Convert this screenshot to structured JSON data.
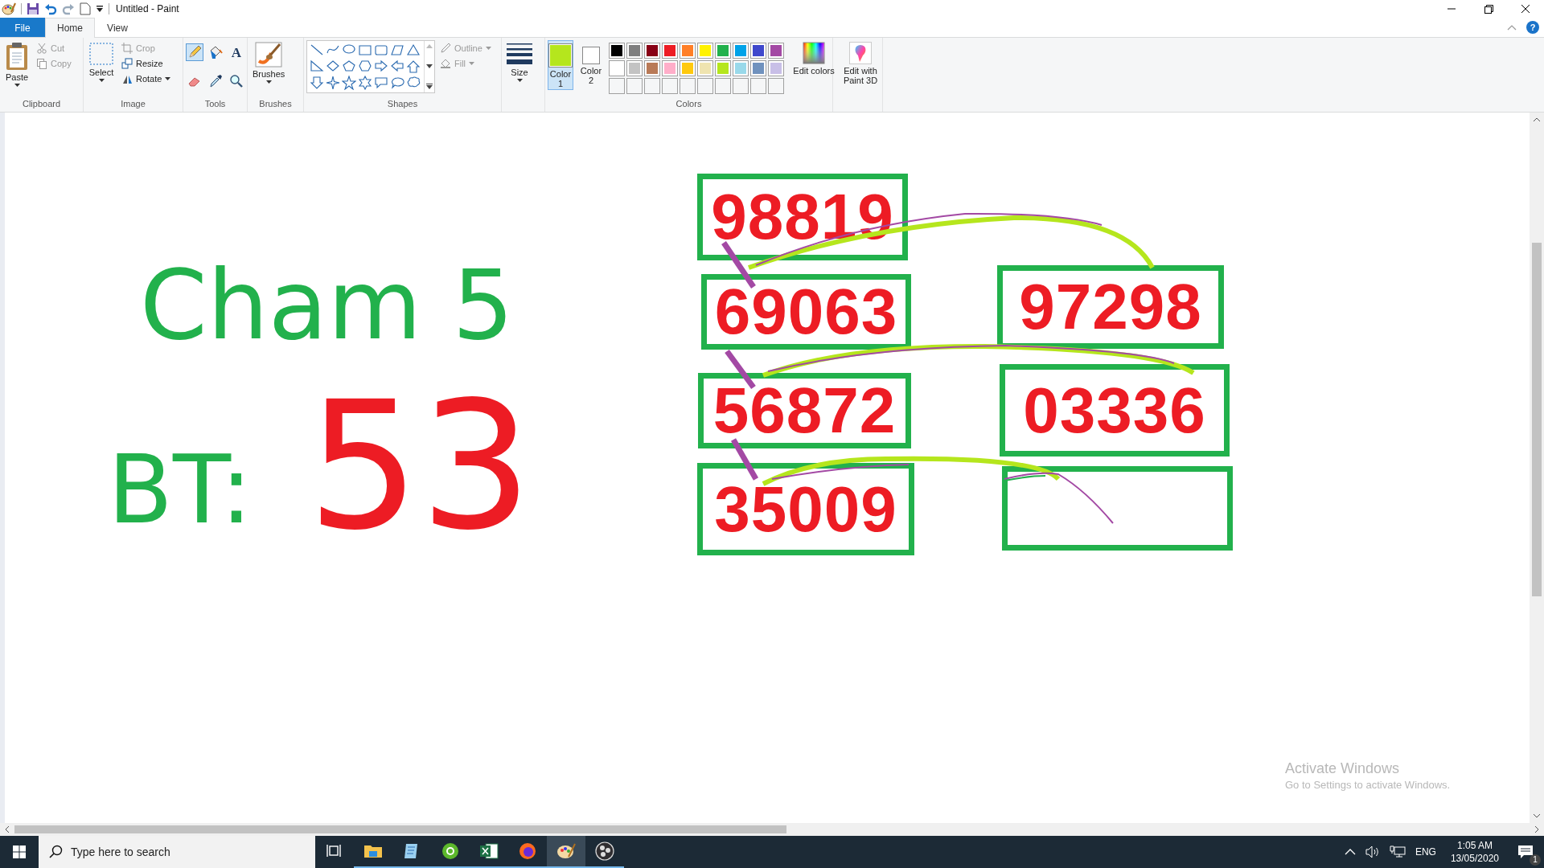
{
  "window": {
    "title": "Untitled - Paint"
  },
  "tabs": [
    {
      "label": "File",
      "kind": "file",
      "selected": false
    },
    {
      "label": "Home",
      "kind": "tab",
      "selected": true
    },
    {
      "label": "View",
      "kind": "tab",
      "selected": false
    }
  ],
  "help": {
    "label": "?"
  },
  "ribbon": {
    "clipboard": {
      "label": "Clipboard",
      "paste": {
        "label": "Paste"
      },
      "cut": {
        "label": "Cut",
        "disabled": true
      },
      "copy": {
        "label": "Copy",
        "disabled": true
      }
    },
    "image": {
      "label": "Image",
      "select": {
        "label": "Select"
      },
      "crop": {
        "label": "Crop",
        "disabled": true
      },
      "resize": {
        "label": "Resize",
        "disabled": false
      },
      "rotate": {
        "label": "Rotate",
        "disabled": false
      }
    },
    "tools": {
      "label": "Tools",
      "items": [
        {
          "kind": "pencil",
          "selected": true
        },
        {
          "kind": "fill",
          "selected": false
        },
        {
          "kind": "text",
          "label": "A",
          "selected": false
        },
        {
          "kind": "eraser",
          "selected": false
        },
        {
          "kind": "picker",
          "selected": false
        },
        {
          "kind": "magnifier",
          "selected": false
        }
      ]
    },
    "brushes": {
      "label": "Brushes",
      "group_label": "Brushes"
    },
    "shapes": {
      "label": "Shapes",
      "outline": {
        "label": "Outline",
        "disabled": true
      },
      "fill": {
        "label": "Fill",
        "disabled": true
      }
    },
    "size": {
      "label": "Size"
    },
    "colors": {
      "label": "Colors",
      "slots": [
        {
          "label": "Color 1",
          "color": "#b5e61d",
          "selected": true
        },
        {
          "label": "Color 2",
          "color": "#ffffff",
          "selected": false
        }
      ],
      "palette": [
        {
          "color": "#000000"
        },
        {
          "color": "#7f7f7f"
        },
        {
          "color": "#880015"
        },
        {
          "color": "#ed1c24"
        },
        {
          "color": "#ff7f27"
        },
        {
          "color": "#fff200"
        },
        {
          "color": "#22b14c"
        },
        {
          "color": "#00a2e8"
        },
        {
          "color": "#3f48cc"
        },
        {
          "color": "#a349a4"
        },
        {
          "color": "#ffffff"
        },
        {
          "color": "#c3c3c3"
        },
        {
          "color": "#b97a57"
        },
        {
          "color": "#ffaec9"
        },
        {
          "color": "#ffc90e"
        },
        {
          "color": "#efe4b0"
        },
        {
          "color": "#b5e61d"
        },
        {
          "color": "#99d9ea"
        },
        {
          "color": "#7092be"
        },
        {
          "color": "#c8bfe7"
        }
      ],
      "edit": {
        "label": "Edit colors"
      }
    },
    "paint3d": {
      "label": "Edit with Paint 3D"
    }
  },
  "canvas": {
    "writing": [
      {
        "text": "Cham 5",
        "color": "#22b14c"
      },
      {
        "text": "BT:",
        "color": "#22b14c"
      },
      {
        "text": "53",
        "color": "#ed1c24"
      }
    ],
    "number_boxes": [
      {
        "text": "98819"
      },
      {
        "text": "69063"
      },
      {
        "text": "56872"
      },
      {
        "text": "35009"
      },
      {
        "text": "97298"
      },
      {
        "text": "03336"
      }
    ]
  },
  "activation": {
    "title": "Activate Windows",
    "subtitle": "Go to Settings to activate Windows."
  },
  "taskbar": {
    "search": {
      "placeholder": "Type here to search"
    },
    "apps": [
      {
        "kind": "taskview",
        "running": false,
        "selected": false
      },
      {
        "kind": "explorer",
        "running": true,
        "selected": false
      },
      {
        "kind": "notepad",
        "running": true,
        "selected": false
      },
      {
        "kind": "green",
        "running": true,
        "selected": false
      },
      {
        "kind": "excel",
        "running": true,
        "selected": false
      },
      {
        "kind": "firefox",
        "running": true,
        "selected": false
      },
      {
        "kind": "paint",
        "running": true,
        "selected": true
      },
      {
        "kind": "obs",
        "running": true,
        "selected": false
      }
    ],
    "tray": {
      "language": "ENG",
      "time": "1:05 AM",
      "date": "13/05/2020",
      "notifications": "1"
    }
  }
}
